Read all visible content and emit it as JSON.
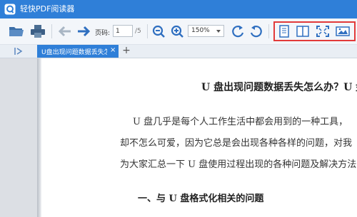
{
  "app": {
    "title": "轻快PDF阅读器"
  },
  "toolbar": {
    "page_label": "页码:",
    "current_page": "1",
    "page_total": "/5",
    "zoom": "150%"
  },
  "tabs": [
    {
      "label": "U盘出现问题数据丢失怎..."
    }
  ],
  "document": {
    "title": "U 盘出现问题数据丢失怎么办？U 盘",
    "paragraph_lines": [
      "U 盘几乎是每个人工作生活中都会用到的一种工具，",
      "却不怎么可爱，因为它总是会出现各种各样的问题，对我",
      "为大家汇总一下 U 盘使用过程出现的各种问题及解决方法"
    ],
    "section_heading": "一、与 U 盘格式化相关的问题"
  },
  "colors": {
    "accent": "#2f7fd8",
    "highlight_box": "#e23a3a",
    "sidebar": "#dcdfe4"
  },
  "icons": [
    "app-logo",
    "open-folder-icon",
    "print-icon",
    "arrow-left-icon",
    "arrow-right-icon",
    "zoom-out-icon",
    "zoom-in-icon",
    "rotate-left-icon",
    "rotate-right-icon",
    "single-page-icon",
    "two-page-icon",
    "fullscreen-icon",
    "slideshow-icon"
  ]
}
